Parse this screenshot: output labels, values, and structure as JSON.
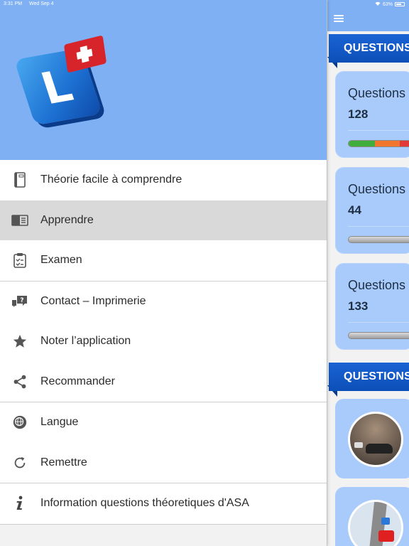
{
  "status_bar": {
    "time": "3:31 PM",
    "date": "Wed Sep 4",
    "battery": "63%"
  },
  "main": {
    "section1_title": "QUESTIONS",
    "section2_title": "QUESTIONS",
    "cards": [
      {
        "title": "Questions",
        "count": "128",
        "progress": {
          "green": 0.45,
          "orange": 0.38,
          "red": 0.17
        }
      },
      {
        "title": "Questions",
        "count": "44",
        "progress": {
          "green": 0,
          "orange": 0,
          "red": 0
        }
      },
      {
        "title": "Questions",
        "count": "133",
        "progress": {
          "green": 0,
          "orange": 0,
          "red": 0
        }
      }
    ]
  },
  "drawer": {
    "items": [
      {
        "label": "Théorie facile à comprendre",
        "icon": "book-icon"
      },
      {
        "label": "Apprendre",
        "icon": "learn-book-icon",
        "active": true
      },
      {
        "label": "Examen",
        "icon": "clipboard-check-icon"
      },
      {
        "label": "Contact – Imprimerie",
        "icon": "chat-question-icon"
      },
      {
        "label": "Noter l’application",
        "icon": "star-icon"
      },
      {
        "label": "Recommander",
        "icon": "share-icon"
      },
      {
        "label": "Langue",
        "icon": "globe-icon"
      },
      {
        "label": "Remettre",
        "icon": "reset-icon"
      },
      {
        "label": "Information questions théoretiques d'ASA",
        "icon": "info-icon"
      }
    ]
  },
  "colors": {
    "header_blue": "#7fb0f3",
    "banner_blue": "#1a63d4",
    "card_blue": "#a9cbfb",
    "active_row": "#d9d9d9"
  }
}
